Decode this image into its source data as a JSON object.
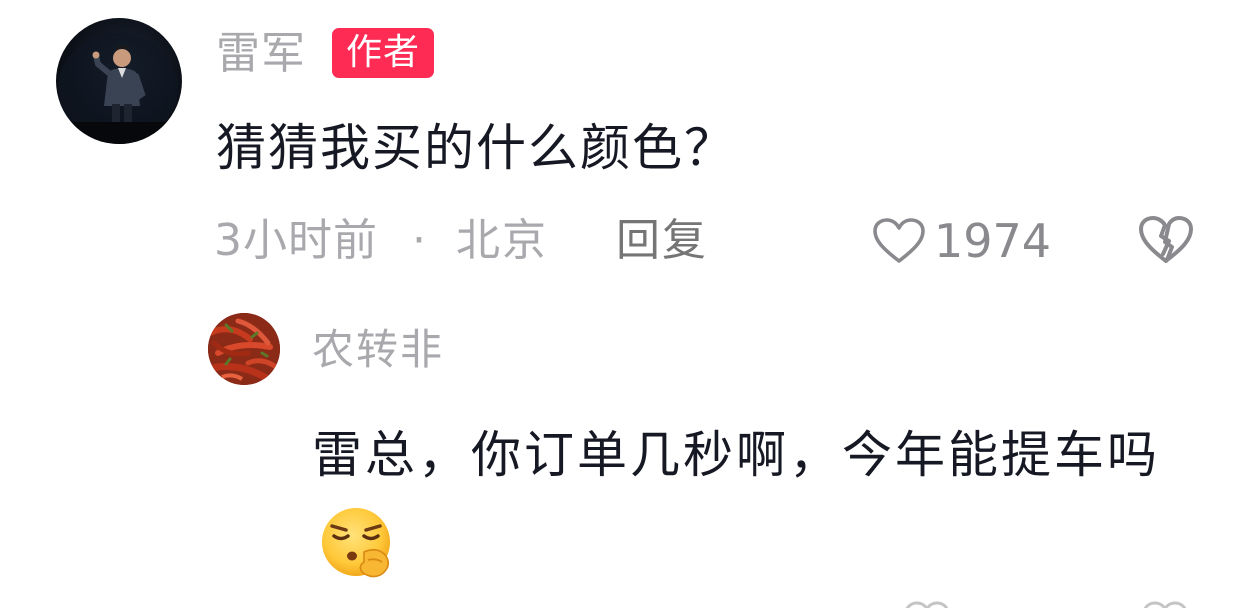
{
  "comment": {
    "author": "雷军",
    "badge": "作者",
    "text": "猜猜我买的什么颜色？",
    "time": "3小时前",
    "separator": "·",
    "location": "北京",
    "reply_label": "回复",
    "likes": "1974",
    "icons": {
      "like": "heart-outline-icon",
      "dislike": "broken-heart-icon"
    },
    "colors": {
      "badge": "#fe2c55",
      "meta": "#a9a9ad",
      "text": "#161823"
    }
  },
  "reply": {
    "author": "农转非",
    "text": "雷总，你订单几秒啊，今年能提车吗",
    "emoji": "shushing-sly-face-emoji"
  }
}
